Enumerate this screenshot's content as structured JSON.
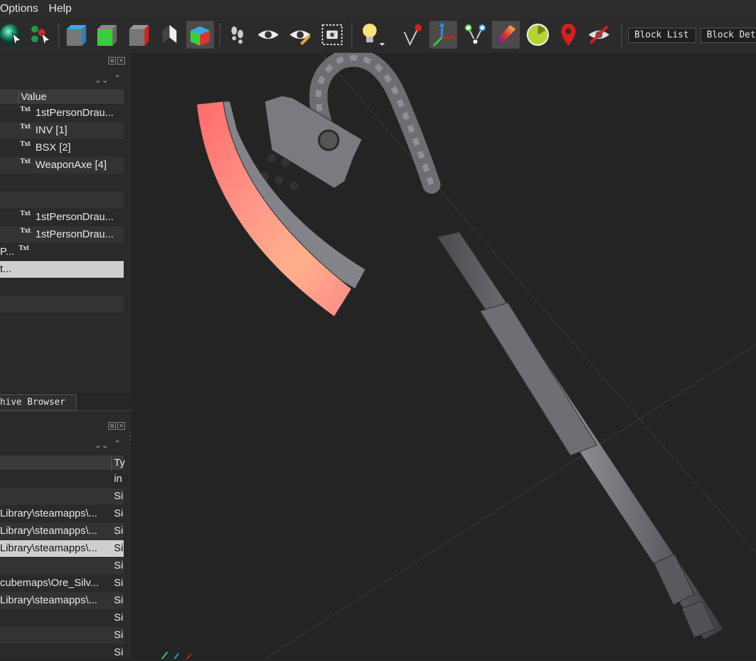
{
  "menu": {
    "options": "Options",
    "help": "Help"
  },
  "toolbar": {
    "block_list": "Block List",
    "block_details": "Block Det"
  },
  "properties_panel": {
    "header_value": "Value",
    "rows": [
      {
        "value": "1stPersonDrau..."
      },
      {
        "value": "INV [1]"
      },
      {
        "value": "BSX [2]"
      },
      {
        "value": "WeaponAxe [4]"
      },
      {
        "value": ""
      },
      {
        "value": ""
      },
      {
        "value": "1stPersonDrau..."
      },
      {
        "value": "1stPersonDrau..."
      },
      {
        "name": "P...",
        "value": ""
      },
      {
        "name": "t...",
        "value": ""
      },
      {
        "value": ""
      },
      {
        "value": ""
      }
    ],
    "badge": "Txt"
  },
  "tabs": {
    "archive_browser": "hive Browser"
  },
  "files_panel": {
    "header_type": "Ty",
    "rows": [
      {
        "path": "",
        "type": "in"
      },
      {
        "path": "",
        "type": "Si"
      },
      {
        "path": "Library\\steamapps\\...",
        "type": "Si"
      },
      {
        "path": "Library\\steamapps\\...",
        "type": "Si"
      },
      {
        "path": "Library\\steamapps\\...",
        "type": "Si"
      },
      {
        "path": "",
        "type": "Si"
      },
      {
        "path": "cubemaps\\Ore_Silv...",
        "type": "Si"
      },
      {
        "path": "Library\\steamapps\\...",
        "type": "Si"
      },
      {
        "path": "",
        "type": "Si"
      },
      {
        "path": "",
        "type": "Si"
      },
      {
        "path": "",
        "type": "Si"
      }
    ]
  },
  "icons": [
    "sphere-icon",
    "pointer-select-icon",
    "cube-blue-icon",
    "cube-green-icon",
    "cube-red-icon",
    "shaded-flat-icon",
    "color-cube-icon",
    "footprints-icon",
    "eye-icon",
    "eye-edit-icon",
    "screenshot-icon",
    "lightbulb-icon",
    "node-marker-icon",
    "axes-icon",
    "vertex-path-icon",
    "gradient-icon",
    "radar-icon",
    "map-pin-icon",
    "hide-icon"
  ],
  "colors": {
    "accent_red": "#d81f1f",
    "accent_green": "#3ccb3c",
    "accent_blue": "#2f8fe0",
    "selection": "#cfcfcf"
  }
}
